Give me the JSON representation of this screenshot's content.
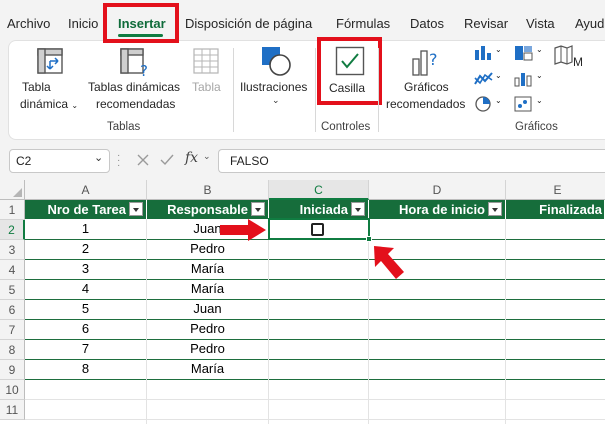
{
  "tabs": [
    "Archivo",
    "Inicio",
    "Insertar",
    "Disposición de página",
    "Fórmulas",
    "Datos",
    "Revisar",
    "Vista",
    "Ayuda"
  ],
  "ribbon": {
    "tabla_dinamica": "Tabla",
    "tabla_dinamica_2": "dinámica",
    "tablas_recomendadas": "Tablas dinámicas",
    "tablas_recomendadas_2": "recomendadas",
    "tabla": "Tabla",
    "group_tablas": "Tablas",
    "ilustraciones": "Ilustraciones",
    "casilla": "Casilla",
    "group_controles": "Controles",
    "graficos_recomendados": "Gráficos",
    "graficos_recomendados_2": "recomendados",
    "group_graficos": "Gráficos",
    "mapa_letter": "M"
  },
  "formula_bar": {
    "name_box": "C2",
    "fx": "fx",
    "value": "FALSO"
  },
  "columns": [
    "A",
    "B",
    "C",
    "D",
    "E"
  ],
  "rows": [
    "1",
    "2",
    "3",
    "4",
    "5",
    "6",
    "7",
    "8",
    "9",
    "10",
    "11"
  ],
  "table": {
    "headers": [
      "Nro de Tarea",
      "Responsable",
      "Iniciada",
      "Hora de inicio",
      "Finalizada"
    ],
    "data": [
      [
        "1",
        "Juan"
      ],
      [
        "2",
        "Pedro"
      ],
      [
        "3",
        "María"
      ],
      [
        "4",
        "María"
      ],
      [
        "5",
        "Juan"
      ],
      [
        "6",
        "Pedro"
      ],
      [
        "7",
        "Pedro"
      ],
      [
        "8",
        "María"
      ]
    ]
  },
  "colors": {
    "accent": "#107c41",
    "table_header": "#166d3b",
    "highlight_box": "#e3101b",
    "arrow": "#e3101b"
  }
}
